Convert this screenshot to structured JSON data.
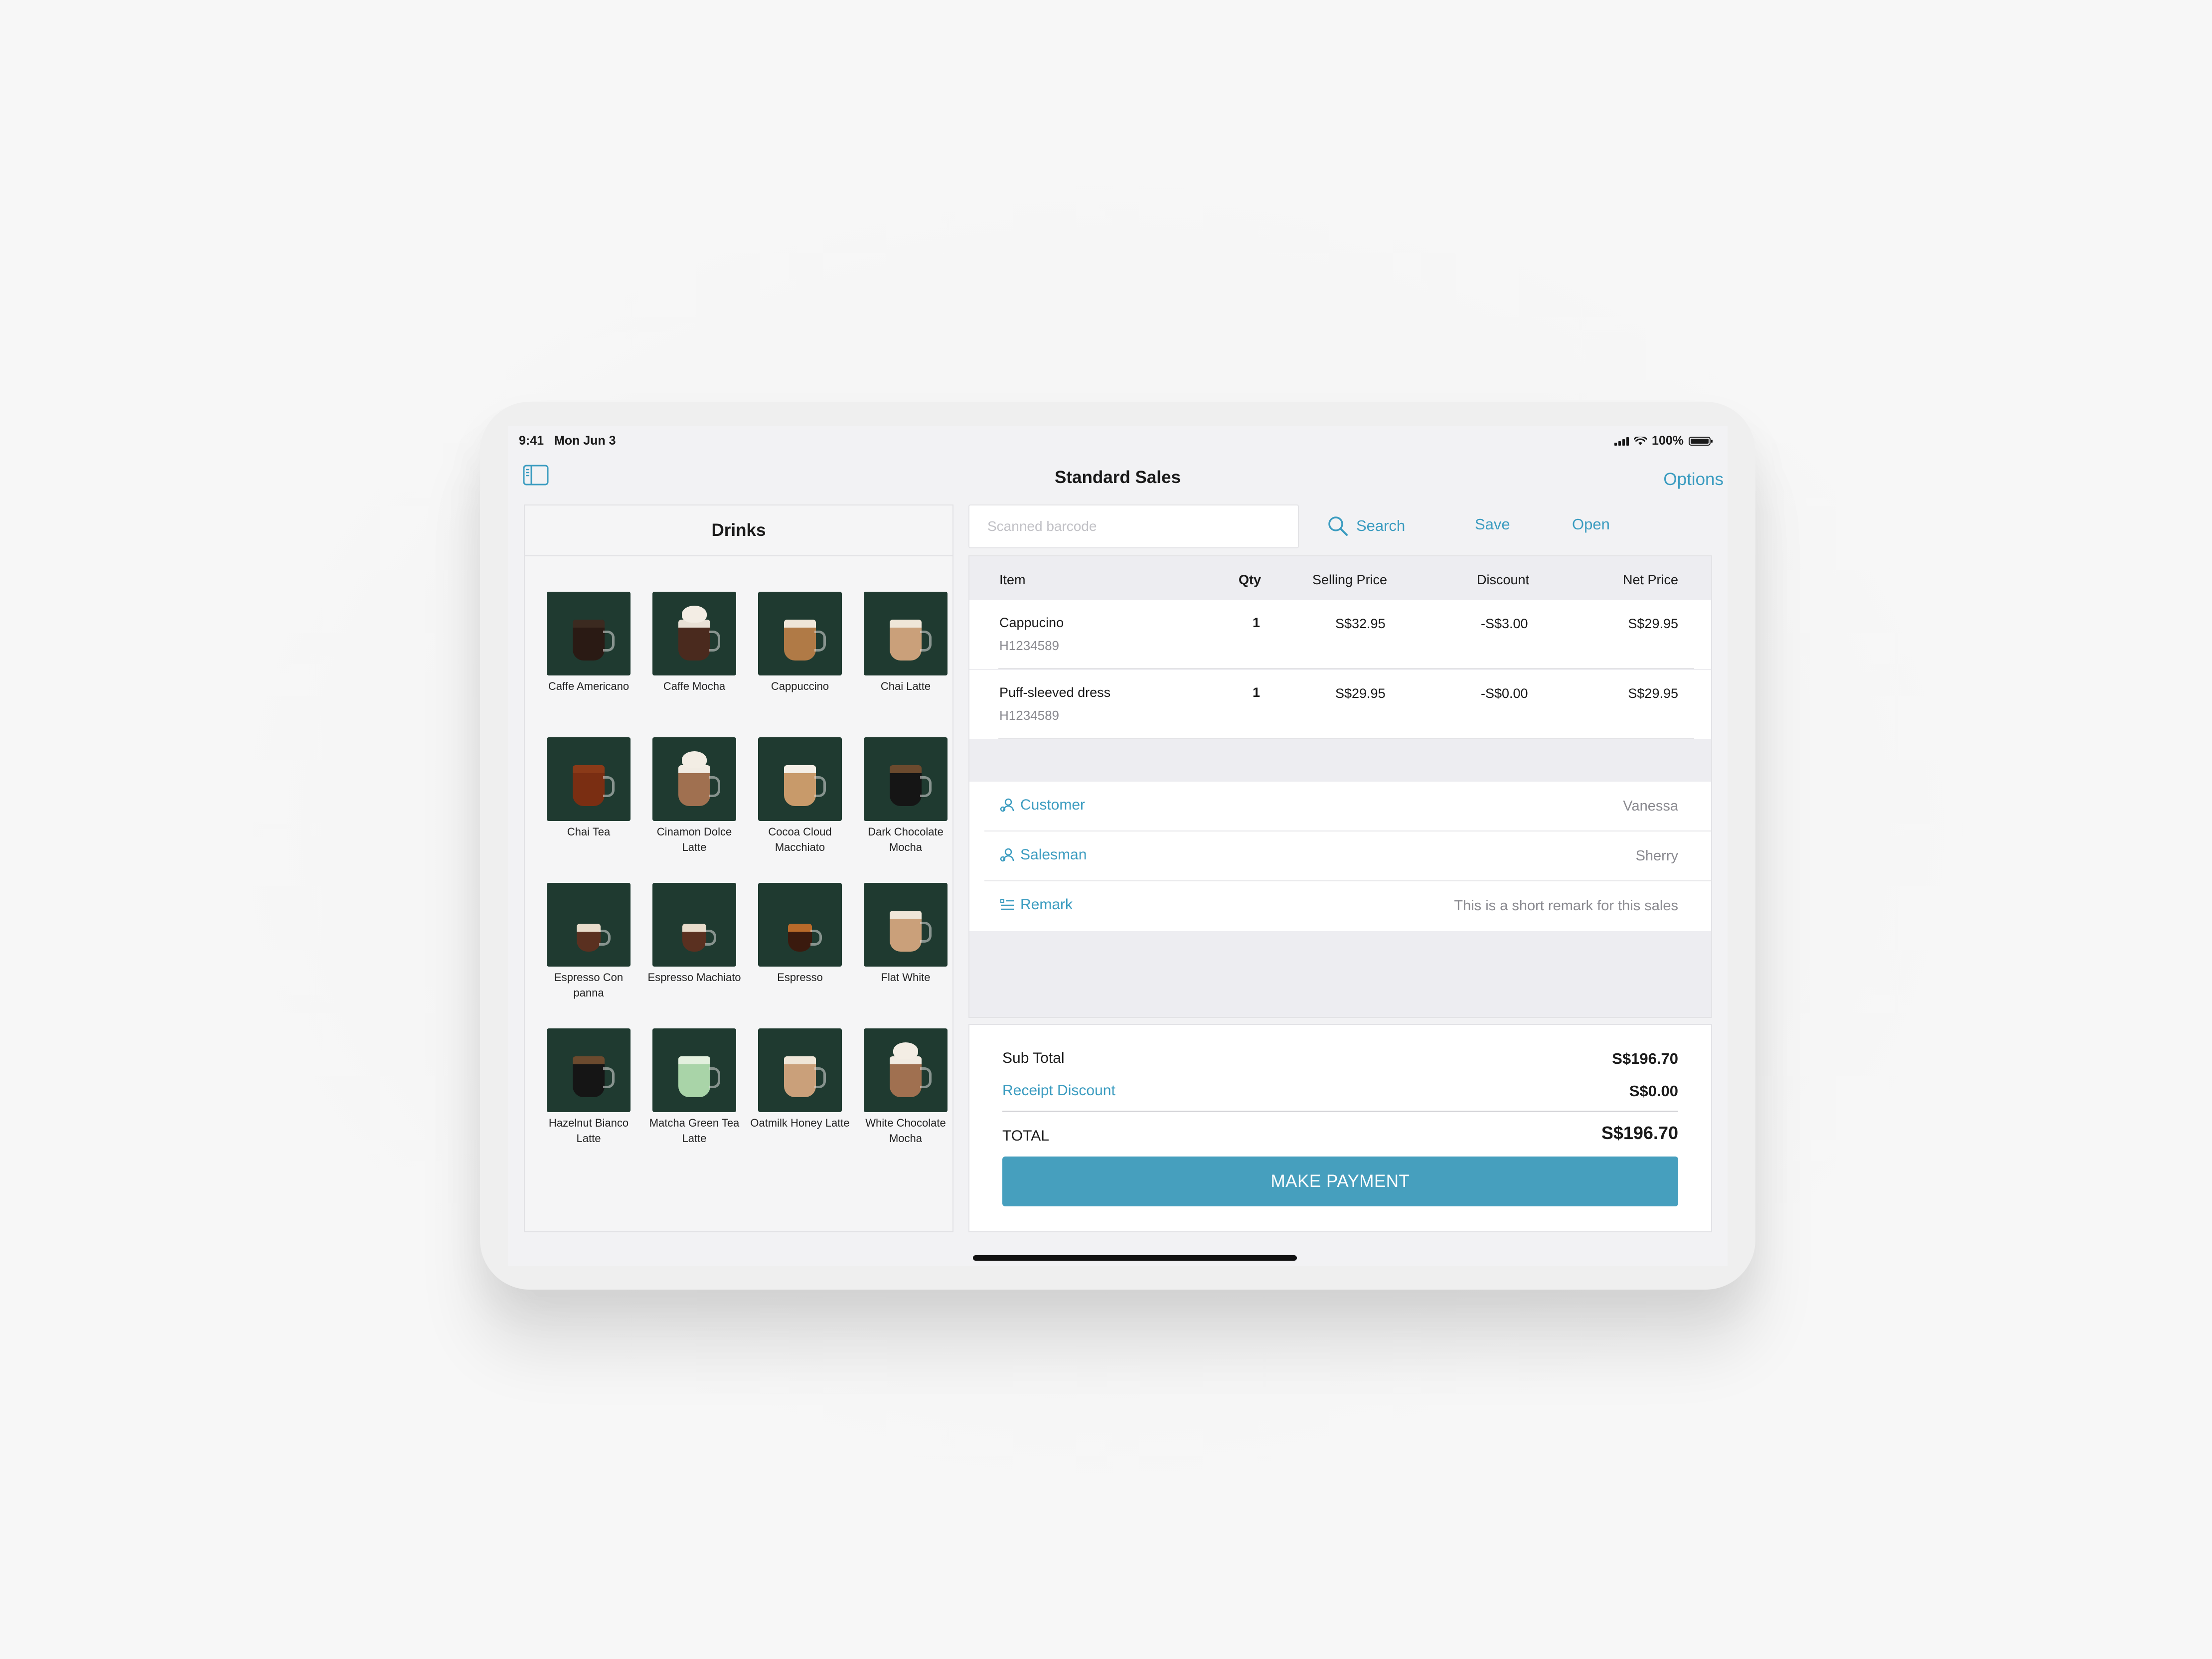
{
  "status_bar": {
    "time": "9:41",
    "date": "Mon Jun 3",
    "battery": "100%"
  },
  "nav": {
    "title": "Standard Sales",
    "options_label": "Options"
  },
  "category": {
    "title": "Drinks",
    "products": [
      {
        "name": "Caffe Americano",
        "style": "dark"
      },
      {
        "name": "Caffe Mocha",
        "style": "mocha"
      },
      {
        "name": "Cappuccino",
        "style": "latte"
      },
      {
        "name": "Chai Latte",
        "style": "light"
      },
      {
        "name": "Chai Tea",
        "style": "tea"
      },
      {
        "name": "Cinamon Dolce Latte",
        "style": "whip"
      },
      {
        "name": "Cocoa Cloud Macchiato",
        "style": "layered"
      },
      {
        "name": "Dark Chocolate Mocha",
        "style": "blackcup"
      },
      {
        "name": "Espresso Con panna",
        "style": "small"
      },
      {
        "name": "Espresso Machiato",
        "style": "small"
      },
      {
        "name": "Espresso",
        "style": "espresso"
      },
      {
        "name": "Flat White",
        "style": "light"
      },
      {
        "name": "Hazelnut Bianco Latte",
        "style": "blackcup"
      },
      {
        "name": "Matcha Green Tea Latte",
        "style": "matcha"
      },
      {
        "name": "Oatmilk Honey Latte",
        "style": "light"
      },
      {
        "name": "White Chocolate Mocha",
        "style": "whip"
      }
    ]
  },
  "toolbar": {
    "barcode_placeholder": "Scanned barcode",
    "search_label": "Search",
    "save_label": "Save",
    "open_label": "Open"
  },
  "table": {
    "columns": {
      "item": "Item",
      "qty": "Qty",
      "selling_price": "Selling Price",
      "discount": "Discount",
      "net_price": "Net Price"
    },
    "rows": [
      {
        "item": "Cappucino",
        "sku": "H1234589",
        "qty": "1",
        "selling_price": "S$32.95",
        "discount": "-S$3.00",
        "net_price": "S$29.95"
      },
      {
        "item": "Puff-sleeved dress",
        "sku": "H1234589",
        "qty": "1",
        "selling_price": "S$29.95",
        "discount": "-S$0.00",
        "net_price": "S$29.95"
      }
    ]
  },
  "details": {
    "customer": {
      "label": "Customer",
      "value": "Vanessa"
    },
    "salesman": {
      "label": "Salesman",
      "value": "Sherry"
    },
    "remark": {
      "label": "Remark",
      "value": "This is a short remark for this sales"
    }
  },
  "summary": {
    "subtotal_label": "Sub Total",
    "subtotal_value": "S$196.70",
    "receipt_discount_label": "Receipt Discount",
    "receipt_discount_value": "S$0.00",
    "total_label": "TOTAL",
    "total_value": "S$196.70",
    "pay_label": "MAKE PAYMENT"
  },
  "colors": {
    "accent": "#3b9cc0",
    "pay_button": "#469fbe",
    "tile_bg": "#1f3a30"
  }
}
